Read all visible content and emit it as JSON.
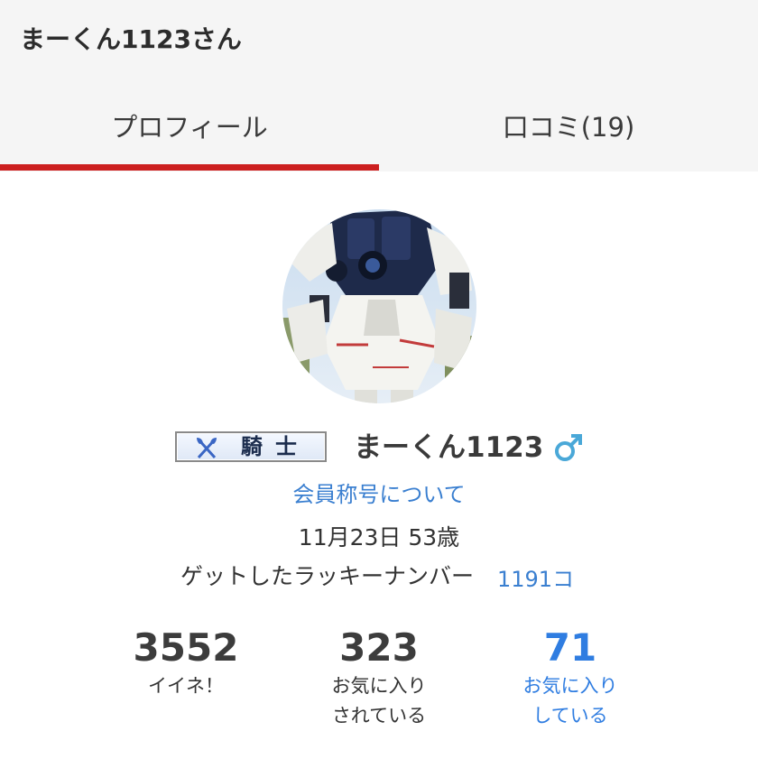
{
  "header": {
    "title": "まーくん1123さん"
  },
  "tabs": [
    {
      "label": "プロフィール",
      "active": true
    },
    {
      "label": "口コミ(19)",
      "active": false
    }
  ],
  "profile": {
    "avatar_icon": "robot-statue-photo",
    "rank_badge": "騎士",
    "rank_icon": "crossed-axes-icon",
    "username": "まーくん1123",
    "gender_icon": "male-symbol-icon",
    "rank_link": "会員称号について",
    "birthday_age": "11月23日 53歳",
    "lucky_label": "ゲットしたラッキーナンバー",
    "lucky_value": "1191コ"
  },
  "stats": [
    {
      "value": "3552",
      "label": "イイネ！"
    },
    {
      "value": "323",
      "label": "お気に入り\nされている"
    },
    {
      "value": "71",
      "label": "お気に入り\nしている"
    }
  ],
  "colors": {
    "accent": "#cc1f1f",
    "link": "#3a7fd0",
    "highlight": "#2f7de1",
    "male": "#4aa8d8",
    "header_bg": "#f5f5f5"
  }
}
